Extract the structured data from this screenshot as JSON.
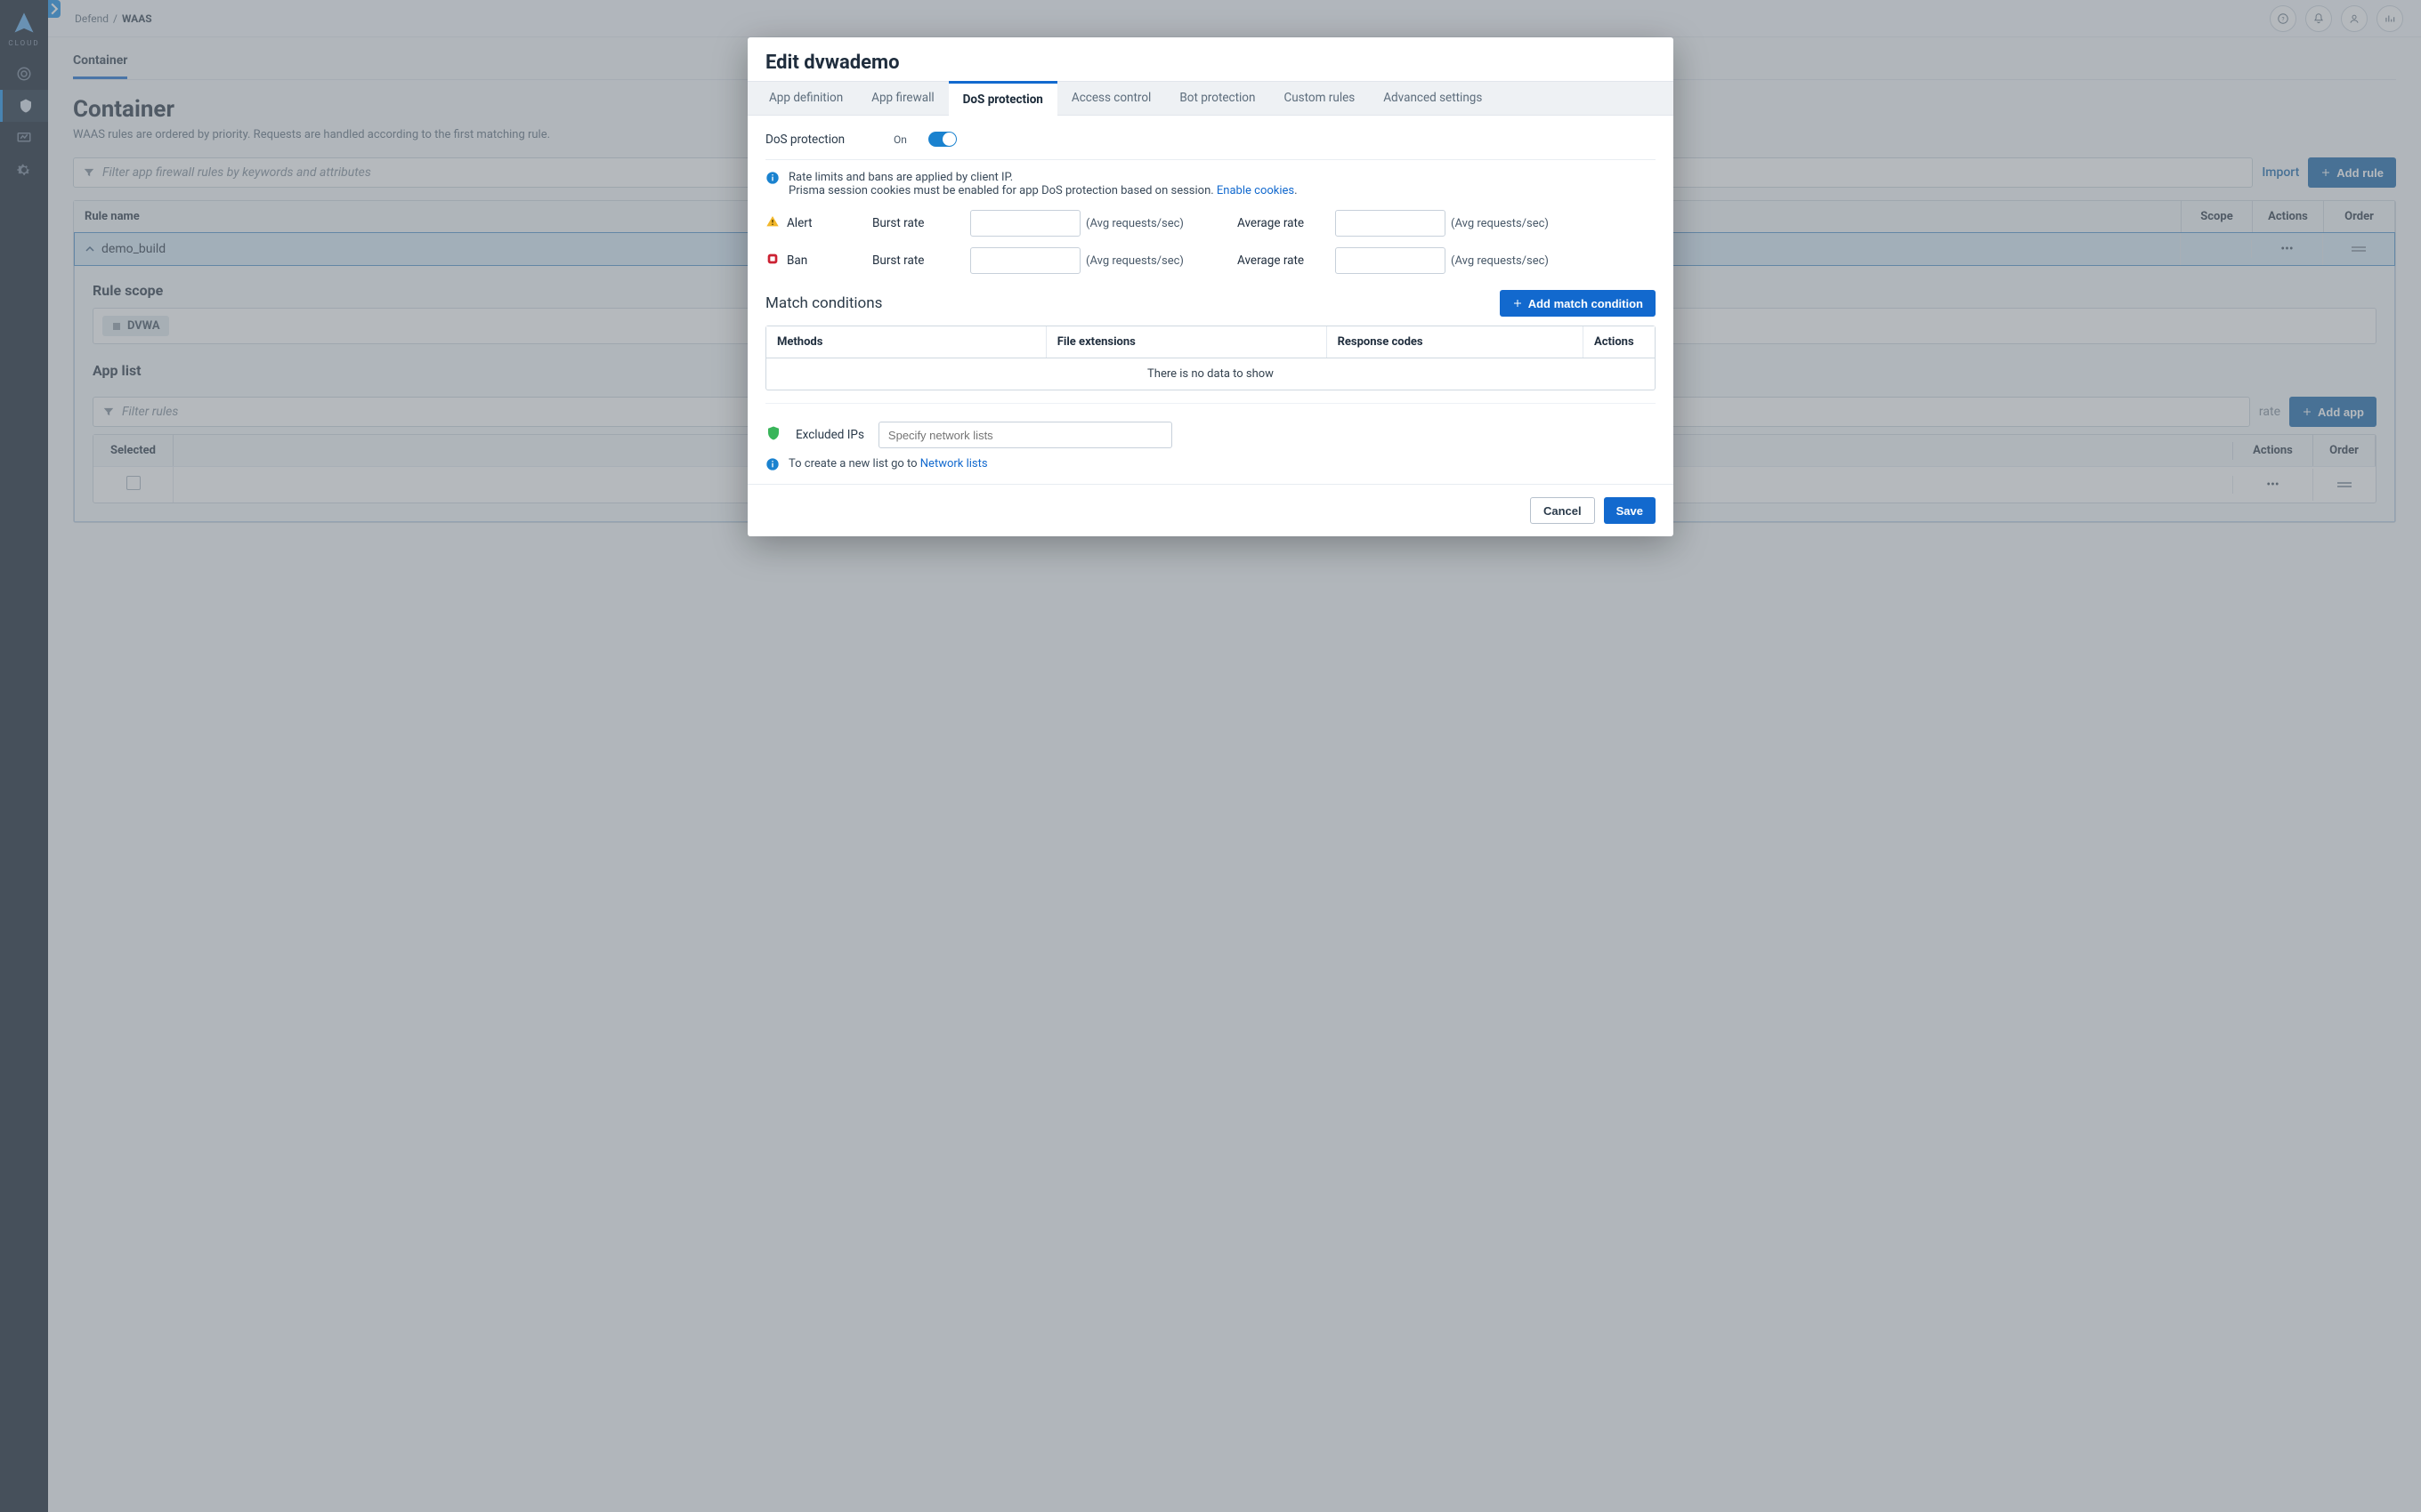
{
  "brandText": "CLOUD",
  "breadcrumbs": {
    "parent": "Defend",
    "sep": "/",
    "current": "WAAS"
  },
  "pageTabs": {
    "container": "Container"
  },
  "pageTitle": "Container",
  "pageSubtitle": "WAAS rules are ordered by priority. Requests are handled according to the first matching rule.",
  "filterPlaceholder": "Filter app firewall rules by keywords and attributes",
  "toolbar": {
    "import": "Import",
    "addRule": "Add rule"
  },
  "waasTable": {
    "headers": {
      "name": "Rule name",
      "scope": "Scope",
      "actions": "Actions",
      "order": "Order"
    },
    "rows": [
      {
        "name": "demo_build"
      }
    ],
    "bullets": "•••"
  },
  "expand": {
    "ruleScope": "Rule scope",
    "chip": "DVWA",
    "appList": "App list",
    "filterRules": "Filter rules",
    "appTable": {
      "headers": {
        "selected": "Selected",
        "rate": "rate",
        "actions": "Actions",
        "order": "Order"
      }
    },
    "addApp": "Add app"
  },
  "modal": {
    "title": "Edit dvwademo",
    "tabs": {
      "appDef": "App definition",
      "appFw": "App firewall",
      "dos": "DoS protection",
      "access": "Access control",
      "bot": "Bot protection",
      "custom": "Custom rules",
      "adv": "Advanced settings"
    },
    "dosLabel": "DoS protection",
    "on": "On",
    "info1": "Rate limits and bans are applied by client IP.",
    "info2a": "Prisma session cookies must be enabled for app DoS protection based on session. ",
    "info2link": "Enable cookies",
    "alert": "Alert",
    "ban": "Ban",
    "burstRate": "Burst rate",
    "avgRate": "Average rate",
    "avgHint": "(Avg requests/sec)",
    "matchConditions": "Match conditions",
    "addMatch": "Add match condition",
    "matchTable": {
      "methods": "Methods",
      "fileExt": "File extensions",
      "respCodes": "Response codes",
      "actions": "Actions",
      "empty": "There is no data to show"
    },
    "excluded": "Excluded IPs",
    "excludedPlaceholder": "Specify network lists",
    "newListPrefix": "To create a new list go to ",
    "newListLink": "Network lists",
    "cancel": "Cancel",
    "save": "Save"
  }
}
